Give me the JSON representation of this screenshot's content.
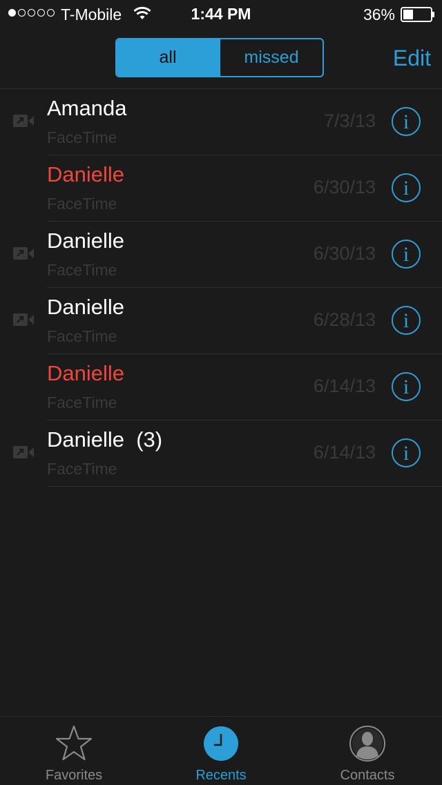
{
  "status_bar": {
    "carrier": "T-Mobile",
    "time": "1:44 PM",
    "battery": "36%",
    "signal_bars": 1,
    "signal_total": 5
  },
  "nav": {
    "segments": [
      "all",
      "missed"
    ],
    "selected_segment": "all",
    "edit_label": "Edit"
  },
  "calls": [
    {
      "name": "Amanda",
      "type": "FaceTime",
      "date": "7/3/13",
      "missed": false,
      "facetime_icon": true
    },
    {
      "name": "Danielle",
      "type": "FaceTime",
      "date": "6/30/13",
      "missed": true,
      "facetime_icon": false
    },
    {
      "name": "Danielle",
      "type": "FaceTime",
      "date": "6/30/13",
      "missed": false,
      "facetime_icon": true
    },
    {
      "name": "Danielle",
      "type": "FaceTime",
      "date": "6/28/13",
      "missed": false,
      "facetime_icon": true
    },
    {
      "name": "Danielle",
      "type": "FaceTime",
      "date": "6/14/13",
      "missed": true,
      "facetime_icon": false
    },
    {
      "name": "Danielle  (3)",
      "type": "FaceTime",
      "date": "6/14/13",
      "missed": false,
      "facetime_icon": true
    }
  ],
  "tab_bar": {
    "tabs": [
      {
        "label": "Favorites",
        "icon": "star-icon"
      },
      {
        "label": "Recents",
        "icon": "clock-icon"
      },
      {
        "label": "Contacts",
        "icon": "contact-silhouette-icon"
      }
    ],
    "active": "Recents"
  },
  "colors": {
    "accent": "#2c9fd9",
    "missed": "#f0463c",
    "background": "#1b1b1b",
    "secondary_text": "#3a3a3a"
  }
}
